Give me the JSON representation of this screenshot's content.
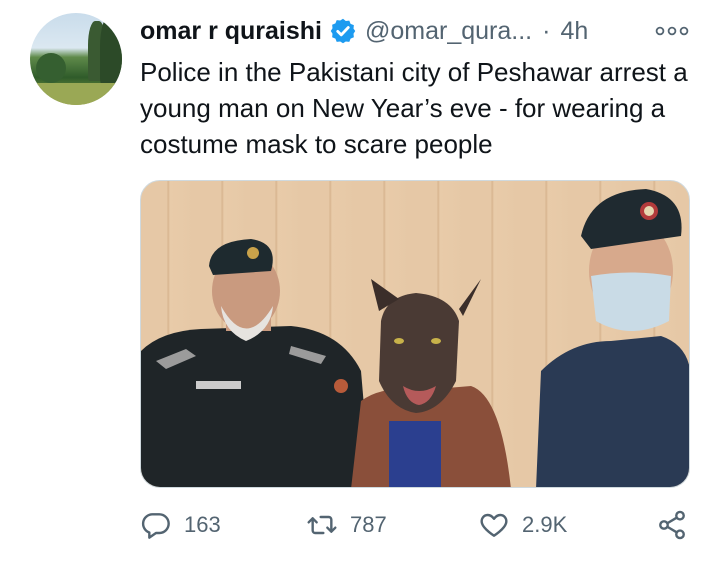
{
  "tweet": {
    "author_name": "omar r quraishi",
    "handle": "@omar_qura...",
    "separator": "·",
    "time": "4h",
    "text": "Police in the Pakistani city of Peshawar arrest a young man on New Year’s eve - for wearing a costume mask to scare people",
    "media_alt": "Photo of two police officers standing beside a person wearing a werewolf costume mask"
  },
  "actions": {
    "replies": "163",
    "retweets": "787",
    "likes": "2.9K"
  },
  "icons": {
    "verified": "verified-badge-icon",
    "more": "more-options-icon",
    "reply": "reply-icon",
    "retweet": "retweet-icon",
    "like": "heart-icon",
    "share": "share-icon"
  },
  "colors": {
    "verified_blue": "#1d9bf0",
    "secondary_text": "#536471",
    "primary_text": "#0f1419"
  }
}
